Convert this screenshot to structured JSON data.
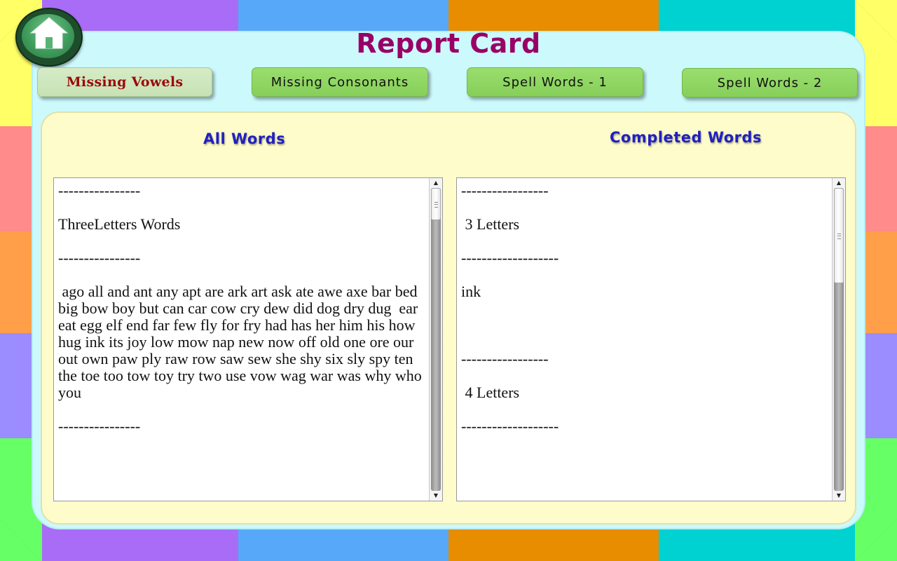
{
  "app": {
    "title": "Report Card"
  },
  "tabs": [
    {
      "label": "Missing Vowels",
      "active": true
    },
    {
      "label": "Missing Consonants",
      "active": false
    },
    {
      "label": "Spell Words - 1",
      "active": false
    },
    {
      "label": "Spell Words - 2",
      "active": false
    }
  ],
  "panels": {
    "all_words": {
      "heading": "All Words",
      "text": "----------------\n\nThreeLetters Words\n\n----------------\n\n ago all and ant any apt are ark art ask ate awe axe bar bed big bow boy but can car cow cry dew did dog dry dug  ear eat egg elf end far few fly for fry had has her him his how hug ink its joy low mow nap new now off old one ore our out own paw ply raw row saw sew she shy six sly spy ten the toe too tow toy try two use vow wag war was why who you\n\n----------------"
    },
    "completed_words": {
      "heading": "Completed Words",
      "text": "-----------------\n\n 3 Letters\n\n-------------------\n\nink\n\n\n\n-----------------\n\n 4 Letters\n\n-------------------"
    }
  },
  "icons": {
    "home": "home-icon",
    "scroll_up": "scroll-up-arrow",
    "scroll_down": "scroll-down-arrow"
  },
  "colors": {
    "title": "#990066",
    "heading": "#2020c0",
    "card": "#ccf9fc",
    "panel": "#fffccc",
    "tab_green": "#8fd660",
    "tab_active": "#cfe6bd",
    "active_tab_text": "#9a0a0a"
  }
}
